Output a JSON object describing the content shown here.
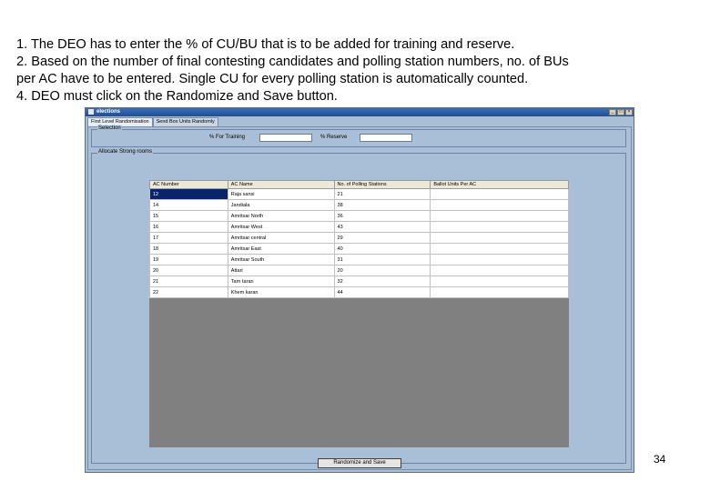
{
  "instructions": [
    "1. The DEO has to enter the % of CU/BU that is to be added for training and reserve.",
    "2. Based on the number of final contesting candidates and polling station numbers, no. of BUs",
    "per AC have to be entered. Single CU for every polling station is automatically counted.",
    "4. DEO must click on the Randomize and Save button."
  ],
  "window": {
    "title": "elections",
    "controls": [
      "_",
      "□",
      "×"
    ]
  },
  "tabs": [
    "First Level Randomisation",
    "Send Box Units Randomly"
  ],
  "selection": {
    "legend": "Selection",
    "training_label": "% For Training",
    "training_value": "",
    "reserve_label": "% Reserve",
    "reserve_value": ""
  },
  "allocate": {
    "legend": "Allocate Strong rooms"
  },
  "table": {
    "columns": [
      "AC Number",
      "AC Name",
      "No. of Polling Stations",
      "Ballot Units Per AC"
    ],
    "rows": [
      [
        "12",
        "Raja sansi",
        "21",
        ""
      ],
      [
        "14",
        "Jandiala",
        "38",
        ""
      ],
      [
        "15",
        "Amritsar North",
        "36",
        ""
      ],
      [
        "16",
        "Amritsar West",
        "43",
        ""
      ],
      [
        "17",
        "Amritsar central",
        "29",
        ""
      ],
      [
        "18",
        "Amritsar East",
        "40",
        ""
      ],
      [
        "19",
        "Amritsar South",
        "31",
        ""
      ],
      [
        "20",
        "Attari",
        "20",
        ""
      ],
      [
        "21",
        "Tarn taran",
        "32",
        ""
      ],
      [
        "22",
        "Khem karan",
        "44",
        ""
      ]
    ],
    "selected_row": 0
  },
  "button_label": "Randomize and Save",
  "page_number": "34"
}
